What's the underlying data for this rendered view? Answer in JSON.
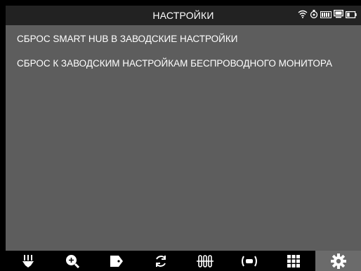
{
  "header": {
    "title": "НАСТРОЙКИ",
    "status_icons": [
      "wifi-icon",
      "tamper-icon",
      "signal-strength-icon",
      "monitor-icon",
      "battery-icon"
    ]
  },
  "menu": {
    "items": [
      {
        "label": "СБРОС SMART HUB В ЗАВОДСКИЕ НАСТРОЙКИ"
      },
      {
        "label": "СБРОС К ЗАВОДСКИМ НАСТРОЙКАМ БЕСПРОВОДНОГО МОНИТОРА"
      }
    ]
  },
  "toolbar": {
    "items": [
      {
        "icon": "plant-stake-icon",
        "active": false
      },
      {
        "icon": "zoom-in-icon",
        "active": false
      },
      {
        "icon": "tag-icon",
        "active": false
      },
      {
        "icon": "refresh-icon",
        "active": false
      },
      {
        "icon": "thermometers-icon",
        "active": false
      },
      {
        "icon": "wireless-sensor-icon",
        "active": false
      },
      {
        "icon": "grid-icon",
        "active": false
      },
      {
        "icon": "settings-gear-icon",
        "active": true
      }
    ]
  },
  "colors": {
    "background": "#5d5d5d",
    "titlebar": "#222222",
    "toolbar": "#000000",
    "active_tab": "#6b6b6b",
    "text": "#ffffff"
  }
}
